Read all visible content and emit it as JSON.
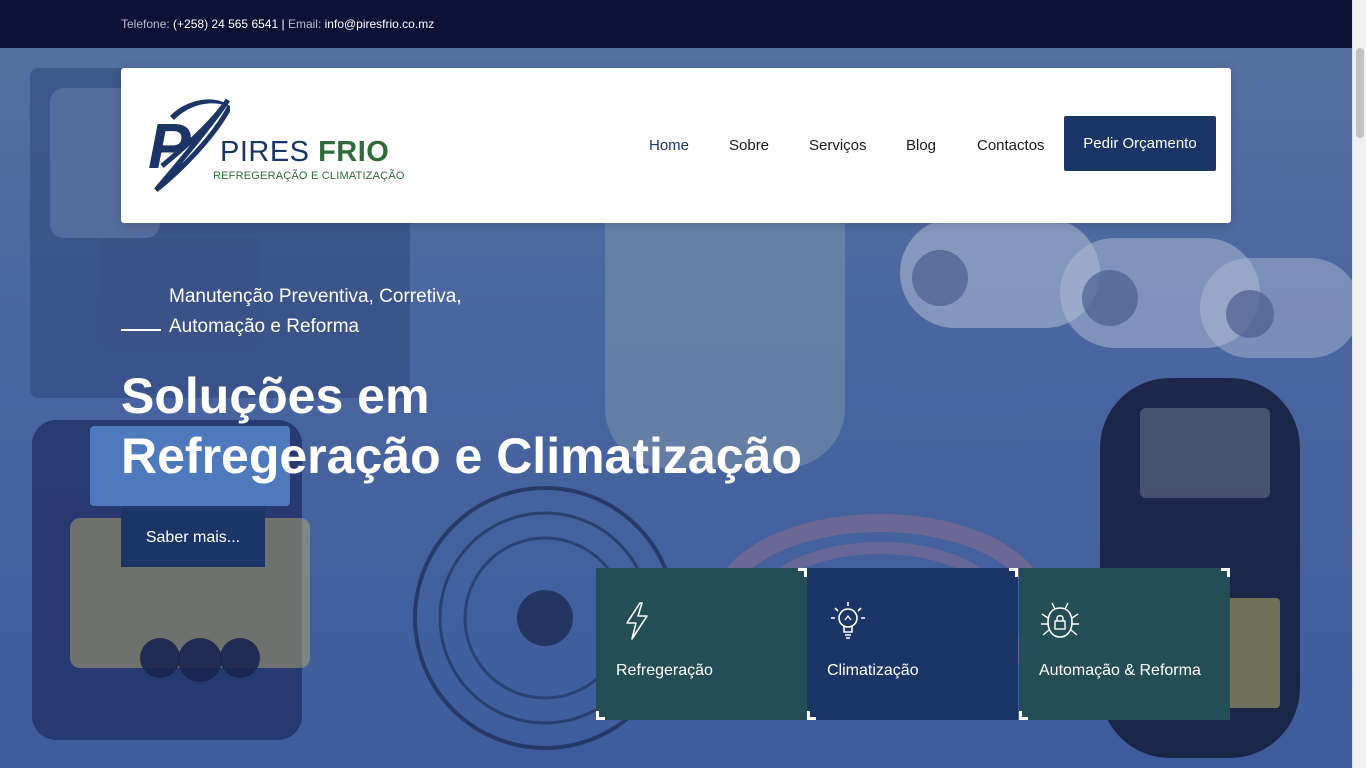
{
  "topbar": {
    "phone_label": "Telefone:",
    "phone_value": "(+258) 24 565 6541",
    "separator": "|",
    "email_label": "Email:",
    "email_value": "info@piresfrio.co.mz"
  },
  "logo": {
    "word1": "PIRES",
    "word2": "FRIO",
    "tagline": "REFREGERAÇÃO E CLIMATIZAÇÃO",
    "colors": {
      "navy": "#1b3566",
      "green": "#2f6b3a"
    }
  },
  "nav": {
    "items": [
      {
        "label": "Home",
        "active": true
      },
      {
        "label": "Sobre",
        "active": false
      },
      {
        "label": "Serviços",
        "active": false
      },
      {
        "label": "Blog",
        "active": false
      },
      {
        "label": "Contactos",
        "active": false
      }
    ],
    "cta": "Pedir Orçamento"
  },
  "hero": {
    "eyebrow": "Manutenção Preventiva, Corretiva, Automação e Reforma",
    "title_line1": "Soluções em",
    "title_line2": "Refregeração e Climatização",
    "button": "Saber mais..."
  },
  "services": [
    {
      "label": "Refregeração",
      "icon": "lightning-icon",
      "color": "#244d55"
    },
    {
      "label": "Climatização",
      "icon": "lightbulb-icon",
      "color": "#1b3566"
    },
    {
      "label": "Automação & Reforma",
      "icon": "security-bug-lock-icon",
      "color": "#244d55"
    }
  ],
  "theme": {
    "primary": "#1b3566",
    "topbar": "#0c1236",
    "teal": "#244d55"
  }
}
